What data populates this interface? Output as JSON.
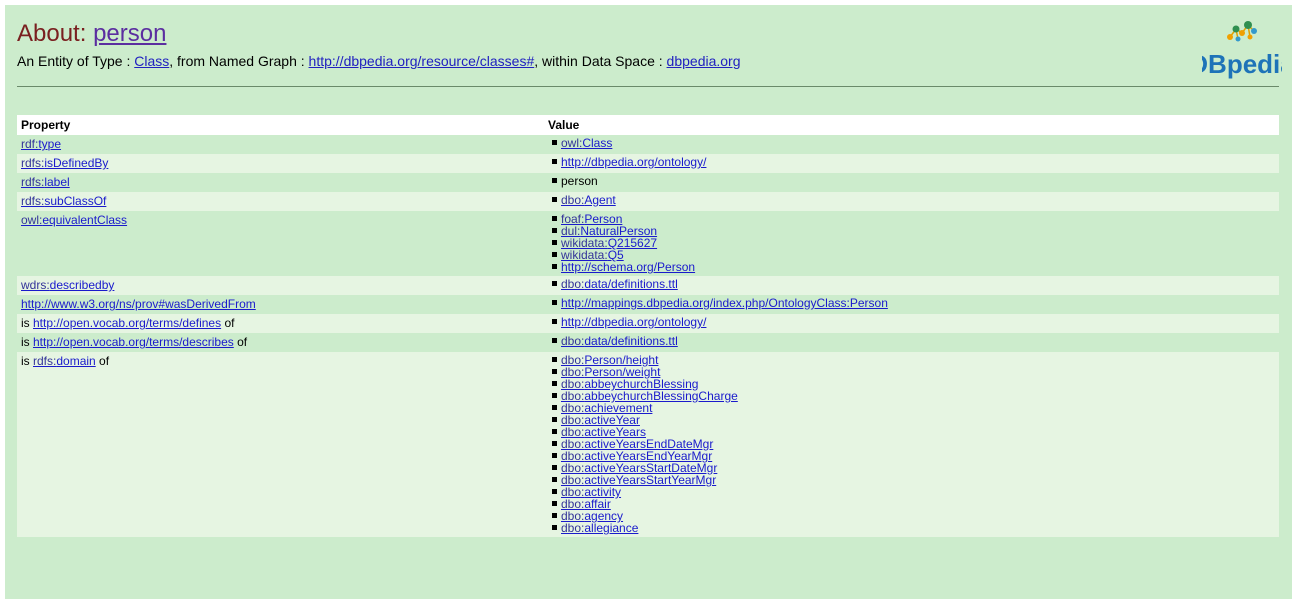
{
  "header": {
    "about_prefix": "About: ",
    "about_entity": "person",
    "subtitle_1": "An Entity of Type : ",
    "type_link": "Class",
    "subtitle_2": ", from Named Graph : ",
    "graph_link": "http://dbpedia.org/resource/classes#",
    "subtitle_3": ", within Data Space : ",
    "space_link": "dbpedia.org",
    "logo_text": "DBpedia"
  },
  "table": {
    "col_property": "Property",
    "col_value": "Value",
    "rows": [
      {
        "ns": "rdf",
        "name": "type",
        "values": [
          {
            "ns": "owl",
            "name": "Class"
          }
        ]
      },
      {
        "ns": "rdfs",
        "name": "isDefinedBy",
        "values": [
          {
            "ns": "",
            "name": "http://dbpedia.org/ontology/"
          }
        ]
      },
      {
        "ns": "rdfs",
        "name": "label",
        "values": [
          {
            "ns": "",
            "name": "person",
            "plain": true
          }
        ]
      },
      {
        "ns": "rdfs",
        "name": "subClassOf",
        "values": [
          {
            "ns": "dbo",
            "name": "Agent"
          }
        ]
      },
      {
        "ns": "owl",
        "name": "equivalentClass",
        "values": [
          {
            "ns": "foaf",
            "name": "Person"
          },
          {
            "ns": "dul",
            "name": "NaturalPerson"
          },
          {
            "ns": "wikidata",
            "name": "Q215627"
          },
          {
            "ns": "wikidata",
            "name": "Q5"
          },
          {
            "ns": "",
            "name": "http://schema.org/Person"
          }
        ]
      },
      {
        "ns": "wdrs",
        "name": "describedby",
        "values": [
          {
            "ns": "dbo",
            "name": "data/definitions.ttl"
          }
        ]
      },
      {
        "ns": "",
        "name": "http://www.w3.org/ns/prov#wasDerivedFrom",
        "values": [
          {
            "ns": "",
            "name": "http://mappings.dbpedia.org/index.php/OntologyClass:Person"
          }
        ]
      },
      {
        "is": "is ",
        "ns": "",
        "name": "http://open.vocab.org/terms/defines",
        "of": " of",
        "values": [
          {
            "ns": "",
            "name": "http://dbpedia.org/ontology/"
          }
        ]
      },
      {
        "is": "is ",
        "ns": "",
        "name": "http://open.vocab.org/terms/describes",
        "of": " of",
        "values": [
          {
            "ns": "dbo",
            "name": "data/definitions.ttl"
          }
        ]
      },
      {
        "is": "is ",
        "ns": "rdfs",
        "name": "domain",
        "of": " of",
        "values": [
          {
            "ns": "dbo",
            "name": "Person/height"
          },
          {
            "ns": "dbo",
            "name": "Person/weight"
          },
          {
            "ns": "dbo",
            "name": "abbeychurchBlessing"
          },
          {
            "ns": "dbo",
            "name": "abbeychurchBlessingCharge"
          },
          {
            "ns": "dbo",
            "name": "achievement"
          },
          {
            "ns": "dbo",
            "name": "activeYear"
          },
          {
            "ns": "dbo",
            "name": "activeYears"
          },
          {
            "ns": "dbo",
            "name": "activeYearsEndDateMgr"
          },
          {
            "ns": "dbo",
            "name": "activeYearsEndYearMgr"
          },
          {
            "ns": "dbo",
            "name": "activeYearsStartDateMgr"
          },
          {
            "ns": "dbo",
            "name": "activeYearsStartYearMgr"
          },
          {
            "ns": "dbo",
            "name": "activity"
          },
          {
            "ns": "dbo",
            "name": "affair"
          },
          {
            "ns": "dbo",
            "name": "agency"
          },
          {
            "ns": "dbo",
            "name": "allegiance"
          }
        ]
      }
    ]
  }
}
